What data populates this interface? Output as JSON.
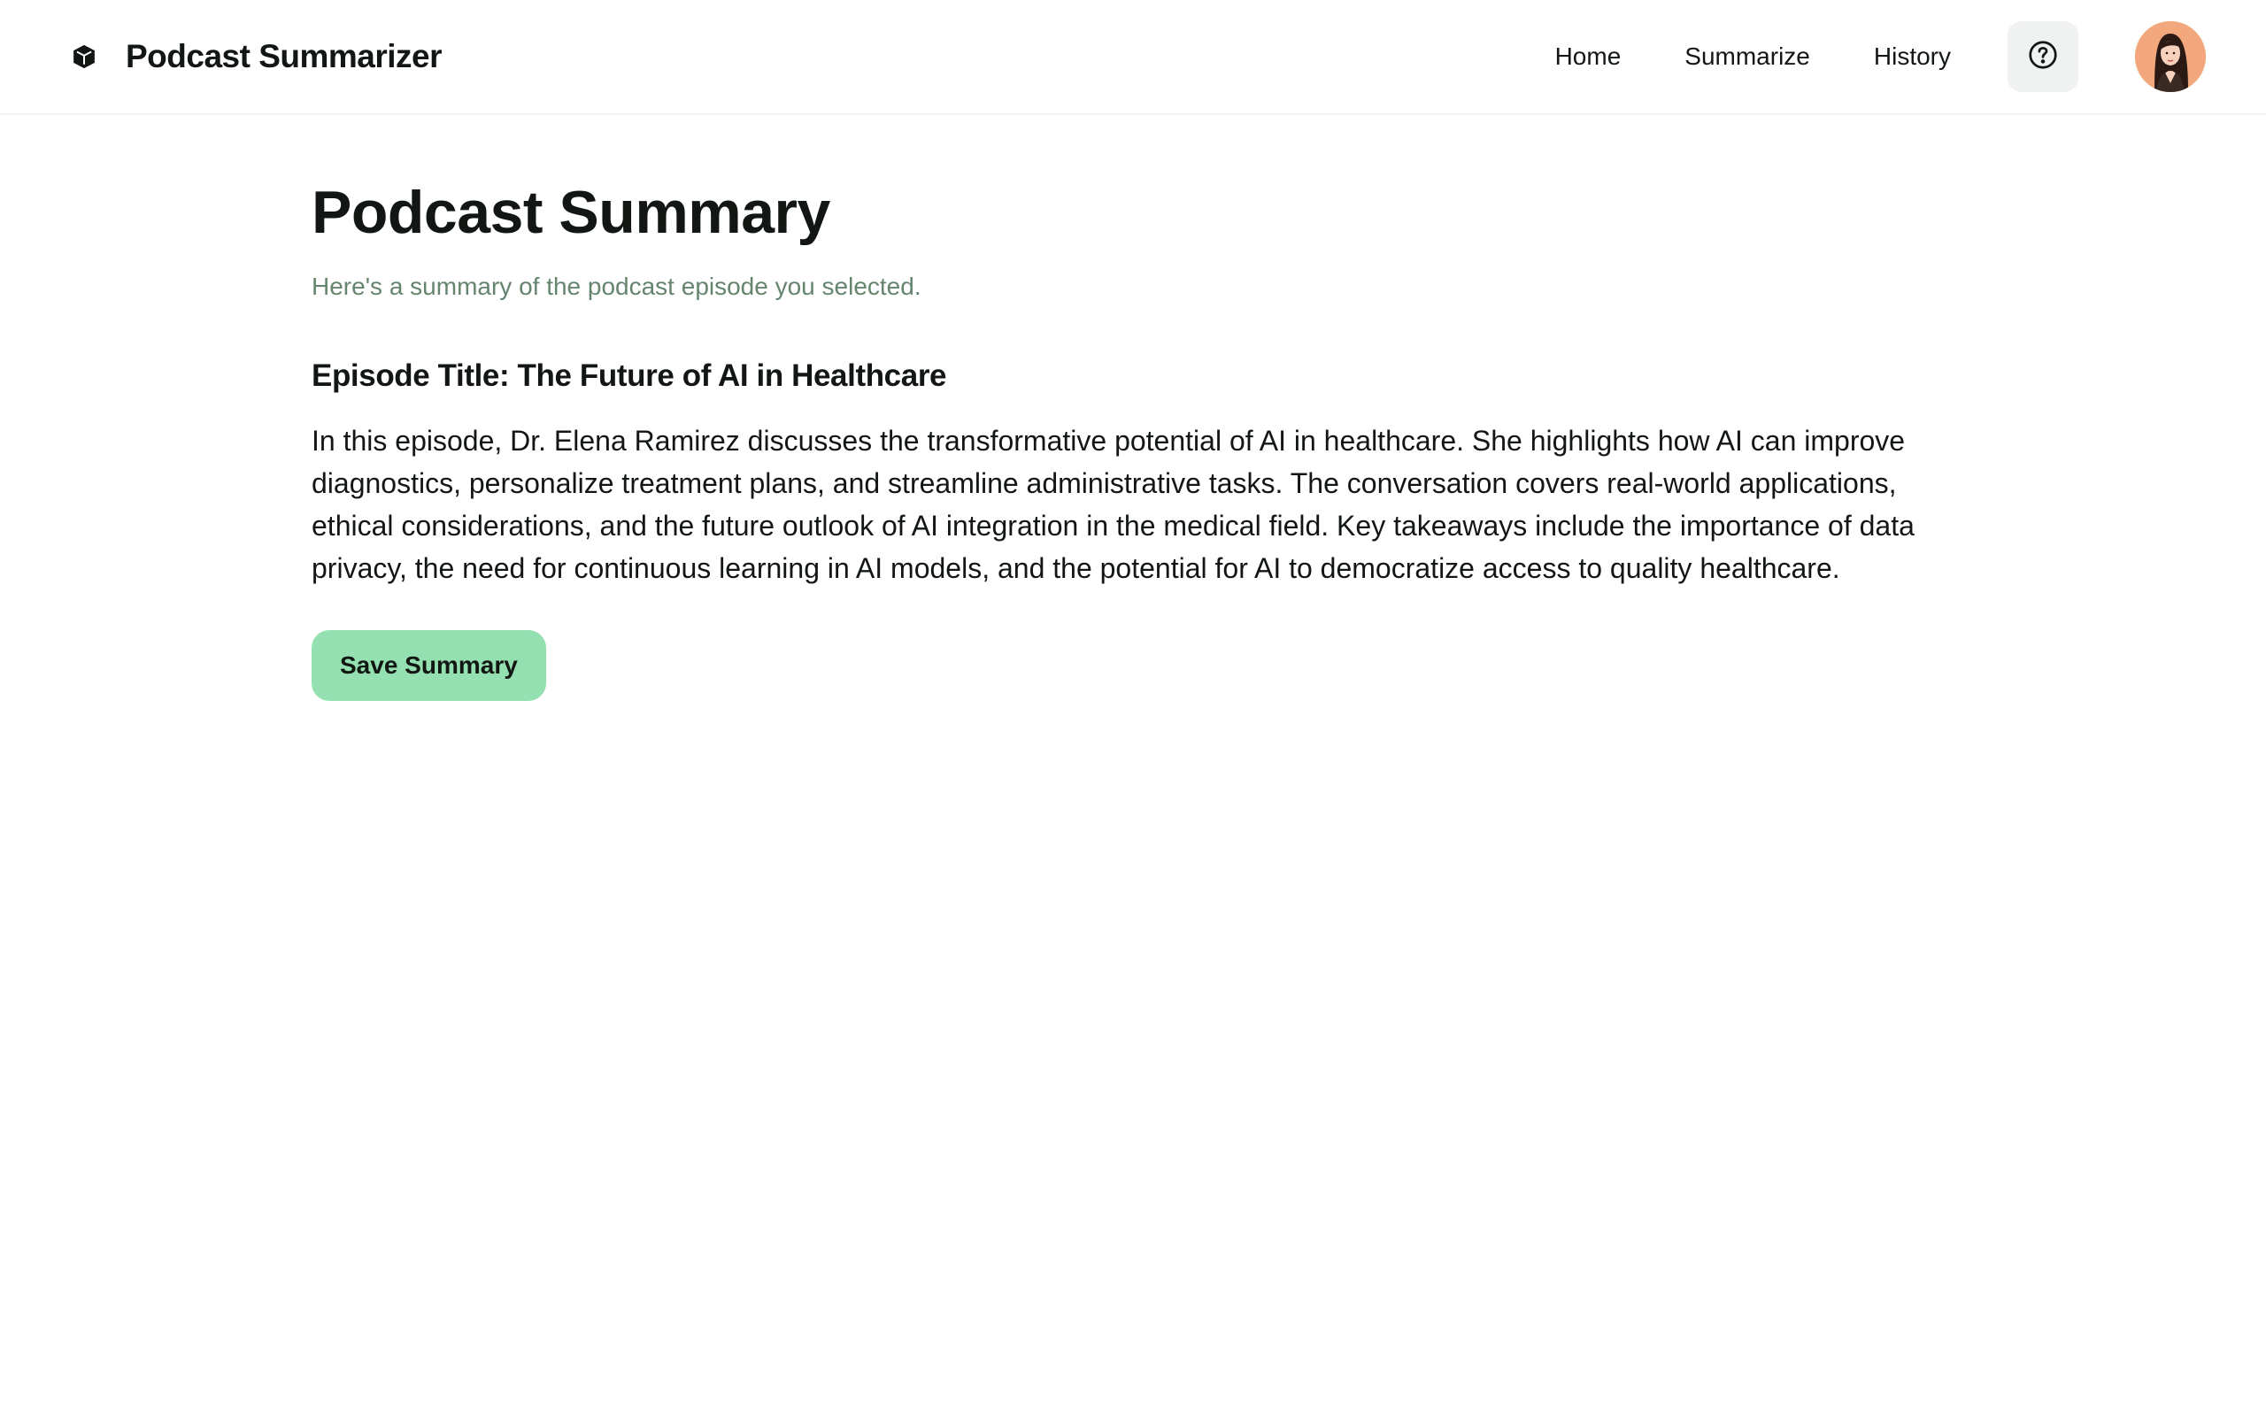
{
  "header": {
    "brand_title": "Podcast Summarizer",
    "brand_icon": "cube-icon",
    "nav": [
      {
        "label": "Home"
      },
      {
        "label": "Summarize"
      },
      {
        "label": "History"
      }
    ],
    "help_icon": "question-circle-icon",
    "avatar": "user-avatar"
  },
  "main": {
    "title": "Podcast Summary",
    "subtitle": "Here's a summary of the podcast episode you selected.",
    "episode_title": "Episode Title: The Future of AI in Healthcare",
    "summary": "In this episode, Dr. Elena Ramirez discusses the transformative potential of AI in healthcare. She highlights how AI can improve diagnostics, personalize treatment plans, and streamline administrative tasks. The conversation covers real-world applications, ethical considerations, and the future outlook of AI integration in the medical field. Key takeaways include the importance of data privacy, the need for continuous learning in AI models, and the potential for AI to democratize access to quality healthcare.",
    "save_button_label": "Save Summary"
  },
  "colors": {
    "accent": "#94e0b0",
    "subtitle": "#66856f",
    "text": "#121714",
    "help_bg": "#f0f2f1"
  }
}
